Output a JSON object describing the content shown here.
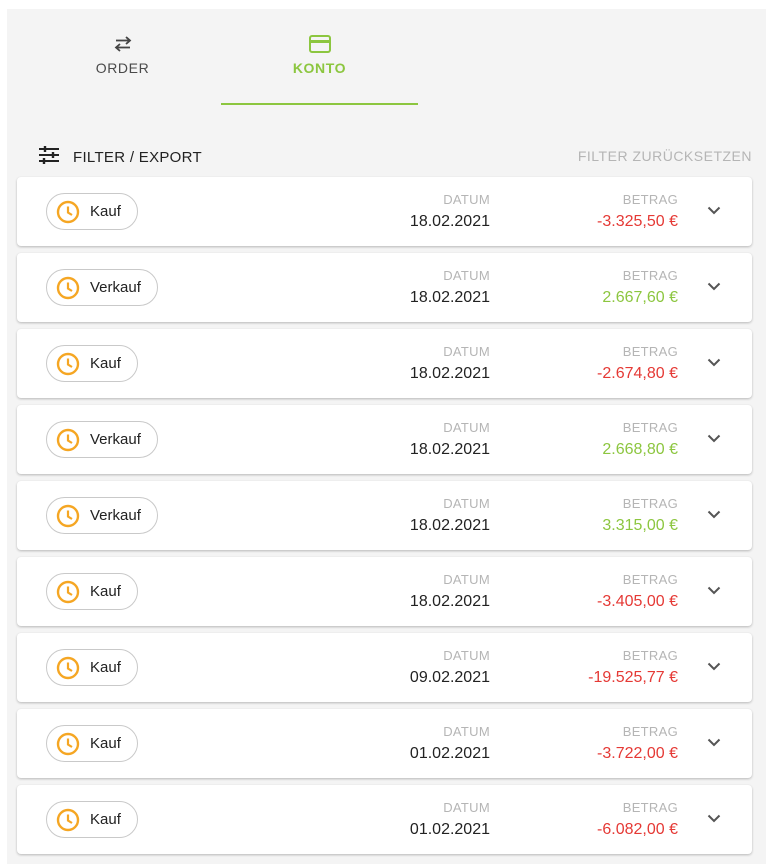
{
  "tabs": {
    "order": {
      "label": "ORDER",
      "icon": "swap-arrows-icon"
    },
    "konto": {
      "label": "KONTO",
      "icon": "credit-card-icon"
    }
  },
  "toolbar": {
    "filter_label": "FILTER / EXPORT",
    "filter_icon": "tune-sliders-icon",
    "reset_label": "FILTER ZURÜCKSETZEN"
  },
  "colors": {
    "accent": "#8cc63f",
    "negative": "#e53935",
    "pending": "#f5a623"
  },
  "column_labels": {
    "datum": "DATUM",
    "betrag": "BETRAG"
  },
  "transactions": [
    {
      "type": "Kauf",
      "date": "18.02.2021",
      "amount": "-3.325,50 €",
      "sign": "neg"
    },
    {
      "type": "Verkauf",
      "date": "18.02.2021",
      "amount": "2.667,60 €",
      "sign": "pos"
    },
    {
      "type": "Kauf",
      "date": "18.02.2021",
      "amount": "-2.674,80 €",
      "sign": "neg"
    },
    {
      "type": "Verkauf",
      "date": "18.02.2021",
      "amount": "2.668,80 €",
      "sign": "pos"
    },
    {
      "type": "Verkauf",
      "date": "18.02.2021",
      "amount": "3.315,00 €",
      "sign": "pos"
    },
    {
      "type": "Kauf",
      "date": "18.02.2021",
      "amount": "-3.405,00 €",
      "sign": "neg"
    },
    {
      "type": "Kauf",
      "date": "09.02.2021",
      "amount": "-19.525,77 €",
      "sign": "neg"
    },
    {
      "type": "Kauf",
      "date": "01.02.2021",
      "amount": "-3.722,00 €",
      "sign": "neg"
    },
    {
      "type": "Kauf",
      "date": "01.02.2021",
      "amount": "-6.082,00 €",
      "sign": "neg"
    }
  ]
}
